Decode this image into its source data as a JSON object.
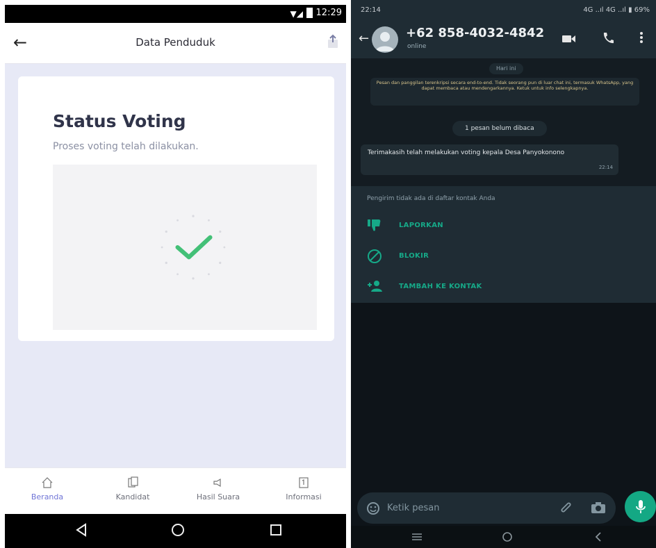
{
  "left_phone": {
    "status_bar": {
      "time": "12:29"
    },
    "header": {
      "title": "Data Penduduk",
      "back_icon": "arrow-left-icon",
      "action_icon": "export-icon"
    },
    "card": {
      "title": "Status Voting",
      "subtitle": "Proses voting telah dilakukan.",
      "illustration_icon": "checkmark-icon"
    },
    "bottom_nav": [
      {
        "label": "Beranda",
        "icon": "home-icon",
        "active": true
      },
      {
        "label": "Kandidat",
        "icon": "candidate-icon",
        "active": false
      },
      {
        "label": "Hasil Suara",
        "icon": "megaphone-icon",
        "active": false
      },
      {
        "label": "Informasi",
        "icon": "info-document-icon",
        "active": false
      }
    ],
    "colors": {
      "accent": "#6f74d6",
      "background": "#e7e9f6",
      "check": "#43c077"
    }
  },
  "right_phone": {
    "status_bar": {
      "time": "22:14",
      "right": "4G ..ıl 4G ..ıl ▮ 69%"
    },
    "header": {
      "contact": "+62 858-4032-4842",
      "status": "online"
    },
    "chat": {
      "date_chip": "Hari ini",
      "encryption_notice": "Pesan dan panggilan terenkripsi secara end-to-end. Tidak seorang pun di luar chat ini, termasuk WhatsApp, yang dapat membaca atau mendengarkannya. Ketuk untuk info selengkapnya.",
      "unread_chip": "1 pesan belum dibaca",
      "message": {
        "text": "Terimakasih telah melakukan voting kepala Desa Panyokonono",
        "time": "22:14"
      }
    },
    "actions": {
      "notice": "Pengirim tidak ada di daftar kontak Anda",
      "items": [
        {
          "label": "LAPORKAN",
          "icon": "thumbs-down-icon"
        },
        {
          "label": "BLOKIR",
          "icon": "block-icon"
        },
        {
          "label": "TAMBAH KE KONTAK",
          "icon": "add-contact-icon"
        }
      ]
    },
    "input": {
      "placeholder": "Ketik pesan"
    },
    "colors": {
      "accent": "#14a884",
      "header": "#1f2c34",
      "background": "#0e1419"
    }
  }
}
